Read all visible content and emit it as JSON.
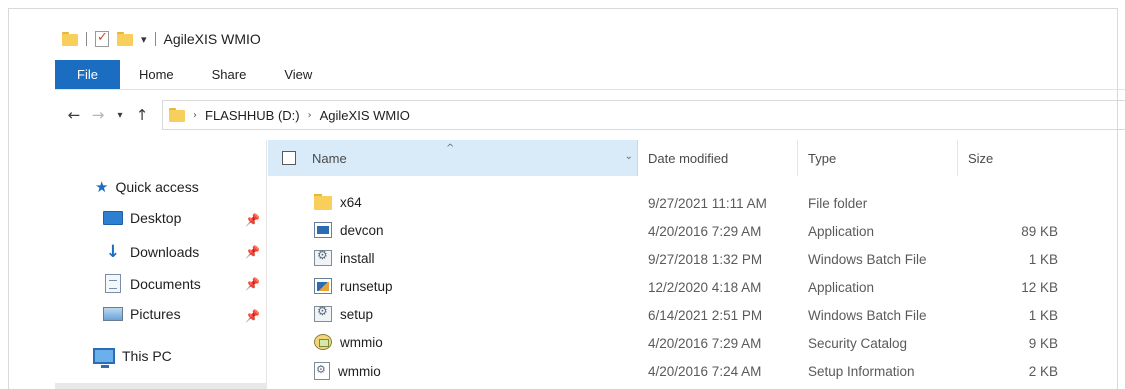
{
  "window": {
    "title": "AgileXIS WMIO"
  },
  "ribbon": {
    "tabs": [
      "File",
      "Home",
      "Share",
      "View"
    ]
  },
  "address_bar": {
    "breadcrumbs": [
      "FLASHHUB (D:)",
      "AgileXIS WMIO"
    ]
  },
  "nav_pane": {
    "quick_access": "Quick access",
    "items": [
      {
        "label": "Desktop",
        "icon": "desktop-icon",
        "pinned": true
      },
      {
        "label": "Downloads",
        "icon": "downloads-icon",
        "pinned": true
      },
      {
        "label": "Documents",
        "icon": "documents-icon",
        "pinned": true
      },
      {
        "label": "Pictures",
        "icon": "pictures-icon",
        "pinned": true
      }
    ],
    "this_pc": "This PC"
  },
  "columns": {
    "name": "Name",
    "date": "Date modified",
    "type": "Type",
    "size": "Size"
  },
  "files": [
    {
      "name": "x64",
      "date": "9/27/2021 11:11 AM",
      "type": "File folder",
      "size": "",
      "icon": "folder"
    },
    {
      "name": "devcon",
      "date": "4/20/2016 7:29 AM",
      "type": "Application",
      "size": "89 KB",
      "icon": "application"
    },
    {
      "name": "install",
      "date": "9/27/2018 1:32 PM",
      "type": "Windows Batch File",
      "size": "1 KB",
      "icon": "batch-file"
    },
    {
      "name": "runsetup",
      "date": "12/2/2020 4:18 AM",
      "type": "Application",
      "size": "12 KB",
      "icon": "setup-application"
    },
    {
      "name": "setup",
      "date": "6/14/2021 2:51 PM",
      "type": "Windows Batch File",
      "size": "1 KB",
      "icon": "batch-file"
    },
    {
      "name": "wmmio",
      "date": "4/20/2016 7:29 AM",
      "type": "Security Catalog",
      "size": "9 KB",
      "icon": "security-catalog"
    },
    {
      "name": "wmmio",
      "date": "4/20/2016 7:24 AM",
      "type": "Setup Information",
      "size": "2 KB",
      "icon": "setup-information"
    }
  ],
  "colors": {
    "file_tab": "#1a6dc0",
    "selected_header": "#d9ebf9",
    "folder": "#f7cf5a"
  }
}
